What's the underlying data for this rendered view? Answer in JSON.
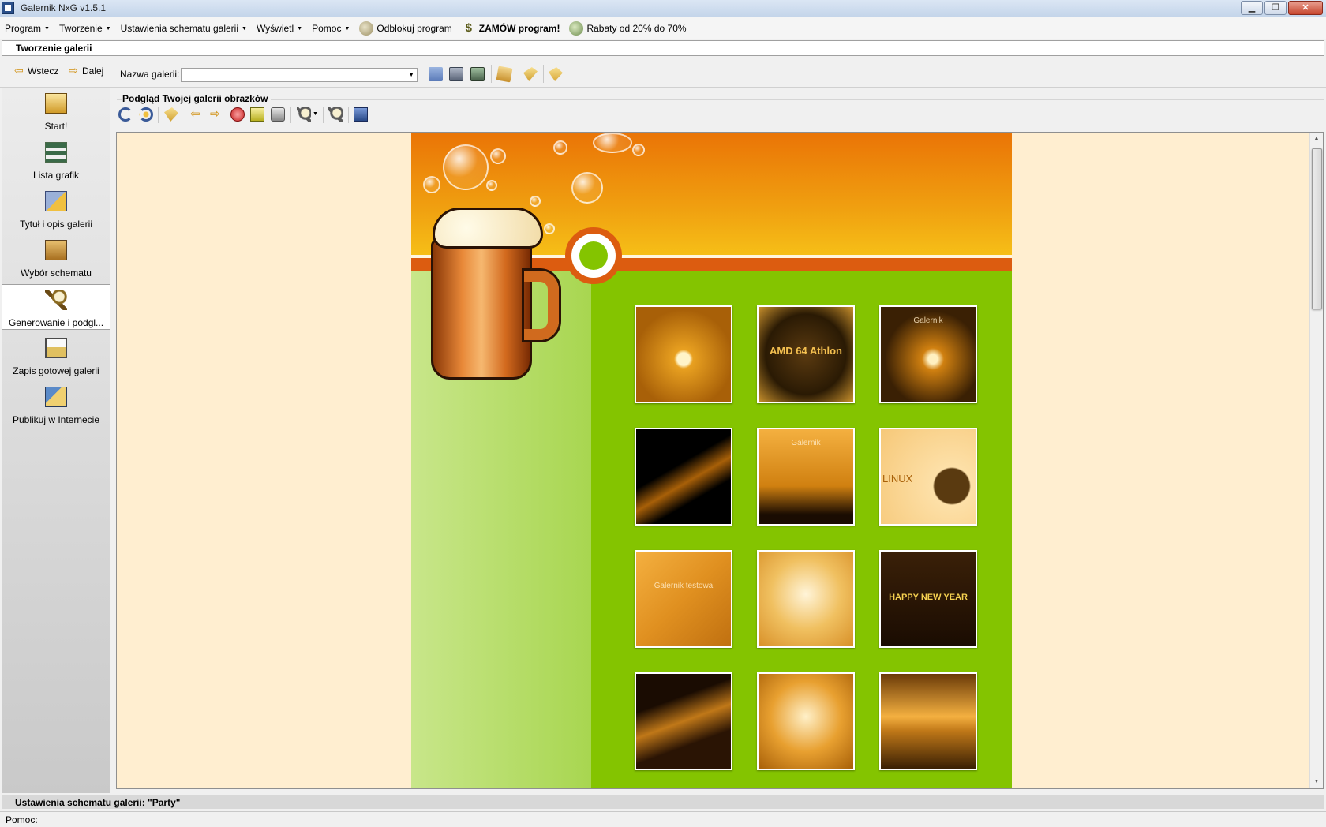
{
  "window": {
    "title": "Galernik NxG v1.5.1"
  },
  "menu": {
    "items": [
      {
        "label": "Program"
      },
      {
        "label": "Tworzenie"
      },
      {
        "label": "Ustawienia schematu galerii"
      },
      {
        "label": "Wyświetl"
      },
      {
        "label": "Pomoc"
      }
    ],
    "unlock_label": "Odblokuj program",
    "order_label": "ZAMÓW program!",
    "discount_label": "Rabaty od 20% do 70%"
  },
  "section": {
    "title": "Tworzenie galerii"
  },
  "toolbar": {
    "back_label": "Wstecz",
    "forward_label": "Dalej",
    "gallery_name_label": "Nazwa galerii:",
    "gallery_name_value": ""
  },
  "sidebar": {
    "items": [
      {
        "label": "Start!"
      },
      {
        "label": "Lista grafik"
      },
      {
        "label": "Tytuł i opis galerii"
      },
      {
        "label": "Wybór schematu"
      },
      {
        "label": "Generowanie i podgl..."
      },
      {
        "label": "Zapis gotowej galerii"
      },
      {
        "label": "Publikuj w Internecie"
      }
    ],
    "active_index": 4
  },
  "preview": {
    "title": "Podgląd Twojej galerii obrazków",
    "thumbnails": [
      {
        "caption": ""
      },
      {
        "caption": "AMD 64 Athlon"
      },
      {
        "caption": "Galernik"
      },
      {
        "caption": ""
      },
      {
        "caption": "Galernik"
      },
      {
        "caption": "LINUX"
      },
      {
        "caption": "Galernik testowa"
      },
      {
        "caption": ""
      },
      {
        "caption": "HAPPY NEW YEAR"
      },
      {
        "caption": ""
      },
      {
        "caption": ""
      },
      {
        "caption": ""
      }
    ]
  },
  "status": {
    "scheme_settings": "Ustawienia schematu galerii: \"Party\"",
    "help_label": "Pomoc:"
  },
  "colors": {
    "site_green": "#84c400",
    "site_orange": "#dc5c10",
    "preview_bg": "#ffeed0"
  }
}
